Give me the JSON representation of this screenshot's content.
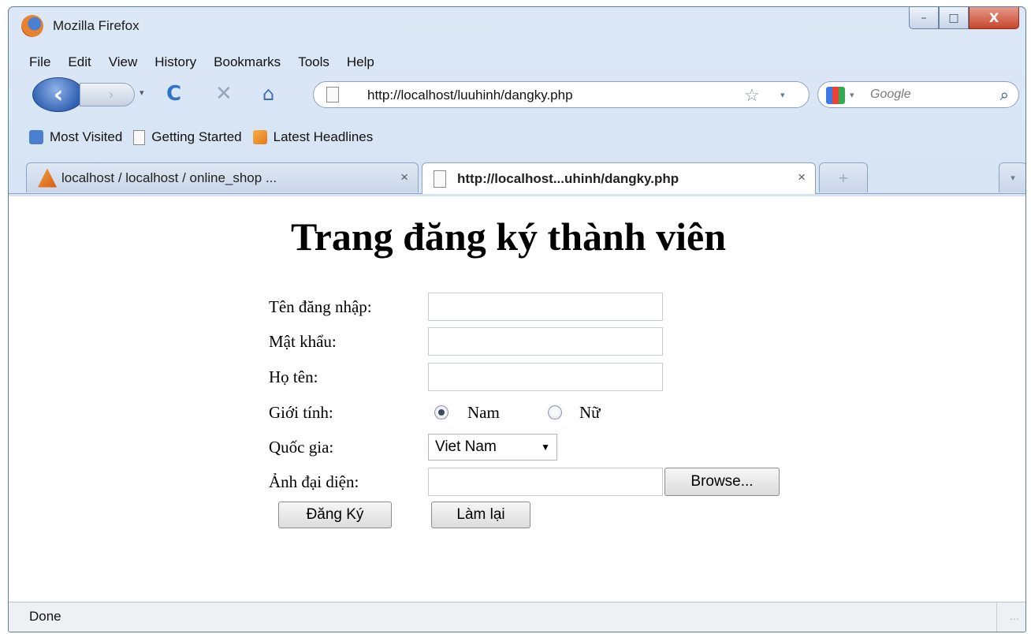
{
  "window": {
    "title": "Mozilla Firefox",
    "controls": {
      "minimize": "–",
      "maximize": "□",
      "close": "X"
    }
  },
  "menu": [
    "File",
    "Edit",
    "View",
    "History",
    "Bookmarks",
    "Tools",
    "Help"
  ],
  "nav": {
    "back": "‹",
    "forward": "›",
    "reload": "C",
    "stop": "✕",
    "home": "⌂",
    "url": "http://localhost/luuhinh/dangky.php",
    "bookmark_star": "☆",
    "dropdown": "▾",
    "search_placeholder": "Google",
    "search_go": "⌕"
  },
  "bookmarks": [
    "Most Visited",
    "Getting Started",
    "Latest Headlines"
  ],
  "tabs": [
    {
      "label": "localhost / localhost / online_shop ...",
      "close": "×",
      "active": false
    },
    {
      "label": "http://localhost...uhinh/dangky.php",
      "close": "×",
      "active": true
    }
  ],
  "tab_new": "+",
  "page": {
    "title": "Trang đăng ký thành viên",
    "form": {
      "username_label": "Tên đăng nhập:",
      "password_label": "Mật khẩu:",
      "fullname_label": "Họ tên:",
      "gender_label": "Giới tính:",
      "gender_options": [
        "Nam",
        "Nữ"
      ],
      "gender_selected": "Nam",
      "country_label": "Quốc gia:",
      "country_value": "Viet Nam",
      "avatar_label": "Ảnh đại diện:",
      "browse_label": "Browse...",
      "submit_label": "Đăng Ký",
      "reset_label": "Làm lại"
    }
  },
  "status": "Done",
  "colors": {
    "chrome": "#c9daf0",
    "close_button": "#c8462d"
  }
}
